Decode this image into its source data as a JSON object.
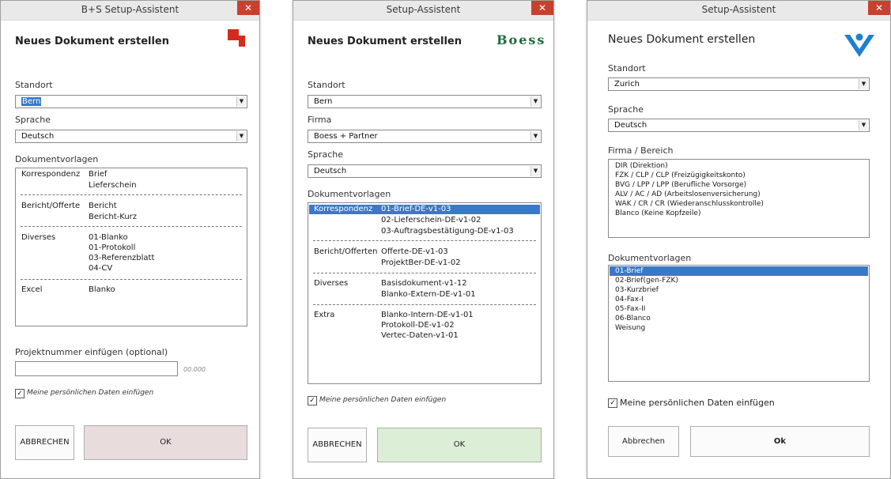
{
  "dialog1": {
    "window_title": "B+S Setup-Assistent",
    "close_glyph": "✕",
    "heading": "Neues Dokument erstellen",
    "standort": {
      "label": "Standort",
      "value": "Bern"
    },
    "sprache": {
      "label": "Sprache",
      "value": "Deutsch"
    },
    "templates_label": "Dokumentvorlagen",
    "groups": [
      {
        "category": "Korrespondenz",
        "items": [
          "Brief",
          "Lieferschein"
        ]
      },
      {
        "category": "Bericht/Offerte",
        "items": [
          "Bericht",
          "Bericht-Kurz"
        ]
      },
      {
        "category": "Diverses",
        "items": [
          "01-Blanko",
          "01-Protokoll",
          "03-Referenzblatt",
          "04-CV"
        ]
      },
      {
        "category": "Excel",
        "items": [
          "Blanko"
        ]
      }
    ],
    "project_label": "Projektnummer einfügen (optional)",
    "project_input": {
      "value": "",
      "placeholder": ""
    },
    "project_hint": "00.000",
    "personal_data_label": "Meine persönlichen Daten einfügen",
    "personal_data_checked": true,
    "cancel_label": "ABBRECHEN",
    "ok_label": "OK",
    "ok_color": "#e8dcdc",
    "logo_color": "#d42b1e"
  },
  "dialog2": {
    "window_title": "Setup-Assistent",
    "close_glyph": "✕",
    "heading": "Neues Dokument erstellen",
    "logo_text": "Boess",
    "logo_color": "#1d6b3a",
    "standort": {
      "label": "Standort",
      "value": "Bern"
    },
    "firma": {
      "label": "Firma",
      "value": "Boess + Partner"
    },
    "sprache": {
      "label": "Sprache",
      "value": "Deutsch"
    },
    "templates_label": "Dokumentvorlagen",
    "groups": [
      {
        "category": "Korrespondenz",
        "items": [
          "01-Brief-DE-v1-03",
          "02-Lieferschein-DE-v1-02",
          "03-Auftragsbestätigung-DE-v1-03"
        ]
      },
      {
        "category": "Bericht/Offerten",
        "items": [
          "Offerte-DE-v1-03",
          "ProjektBer-DE-v1-02"
        ]
      },
      {
        "category": "Diverses",
        "items": [
          "Basisdokument-v1-12",
          "Blanko-Extern-DE-v1-01"
        ]
      },
      {
        "category": "Extra",
        "items": [
          "Blanko-Intern-DE-v1-01",
          "Protokoll-DE-v1-02",
          "Vertec-Daten-v1-01"
        ]
      }
    ],
    "personal_data_label": "Meine persönlichen Daten einfügen",
    "personal_data_checked": true,
    "cancel_label": "ABBRECHEN",
    "ok_label": "OK",
    "ok_color": "#dcefd6"
  },
  "dialog3": {
    "window_title": "Setup-Assistent",
    "close_glyph": "✕",
    "heading": "Neues Dokument erstellen",
    "logo_color": "#1f7fd0",
    "standort": {
      "label": "Standort",
      "value": "Zurich"
    },
    "sprache": {
      "label": "Sprache",
      "value": "Deutsch"
    },
    "firma_label": "Firma / Bereich",
    "firma_items": [
      "DIR (Direktion)",
      "FZK / CLP / CLP (Freizügigkeitskonto)",
      "BVG / LPP / LPP (Berufliche Vorsorge)",
      "ALV / AC / AD (Arbeitslosenversicherung)",
      "WAK / CR / CR (Wiederanschlusskontrolle)",
      "Blanco (Keine Kopfzeile)"
    ],
    "templates_label": "Dokumentvorlagen",
    "templates": [
      "01-Brief",
      "02-Brief(gen-FZK)",
      "03-Kurzbrief",
      "04-Fax-I",
      "05-Fax-II",
      "06-Blanco",
      "Weisung"
    ],
    "personal_data_label": "Meine persönlichen Daten einfügen",
    "personal_data_checked": true,
    "cancel_label": "Abbrechen",
    "ok_label": "Ok"
  }
}
